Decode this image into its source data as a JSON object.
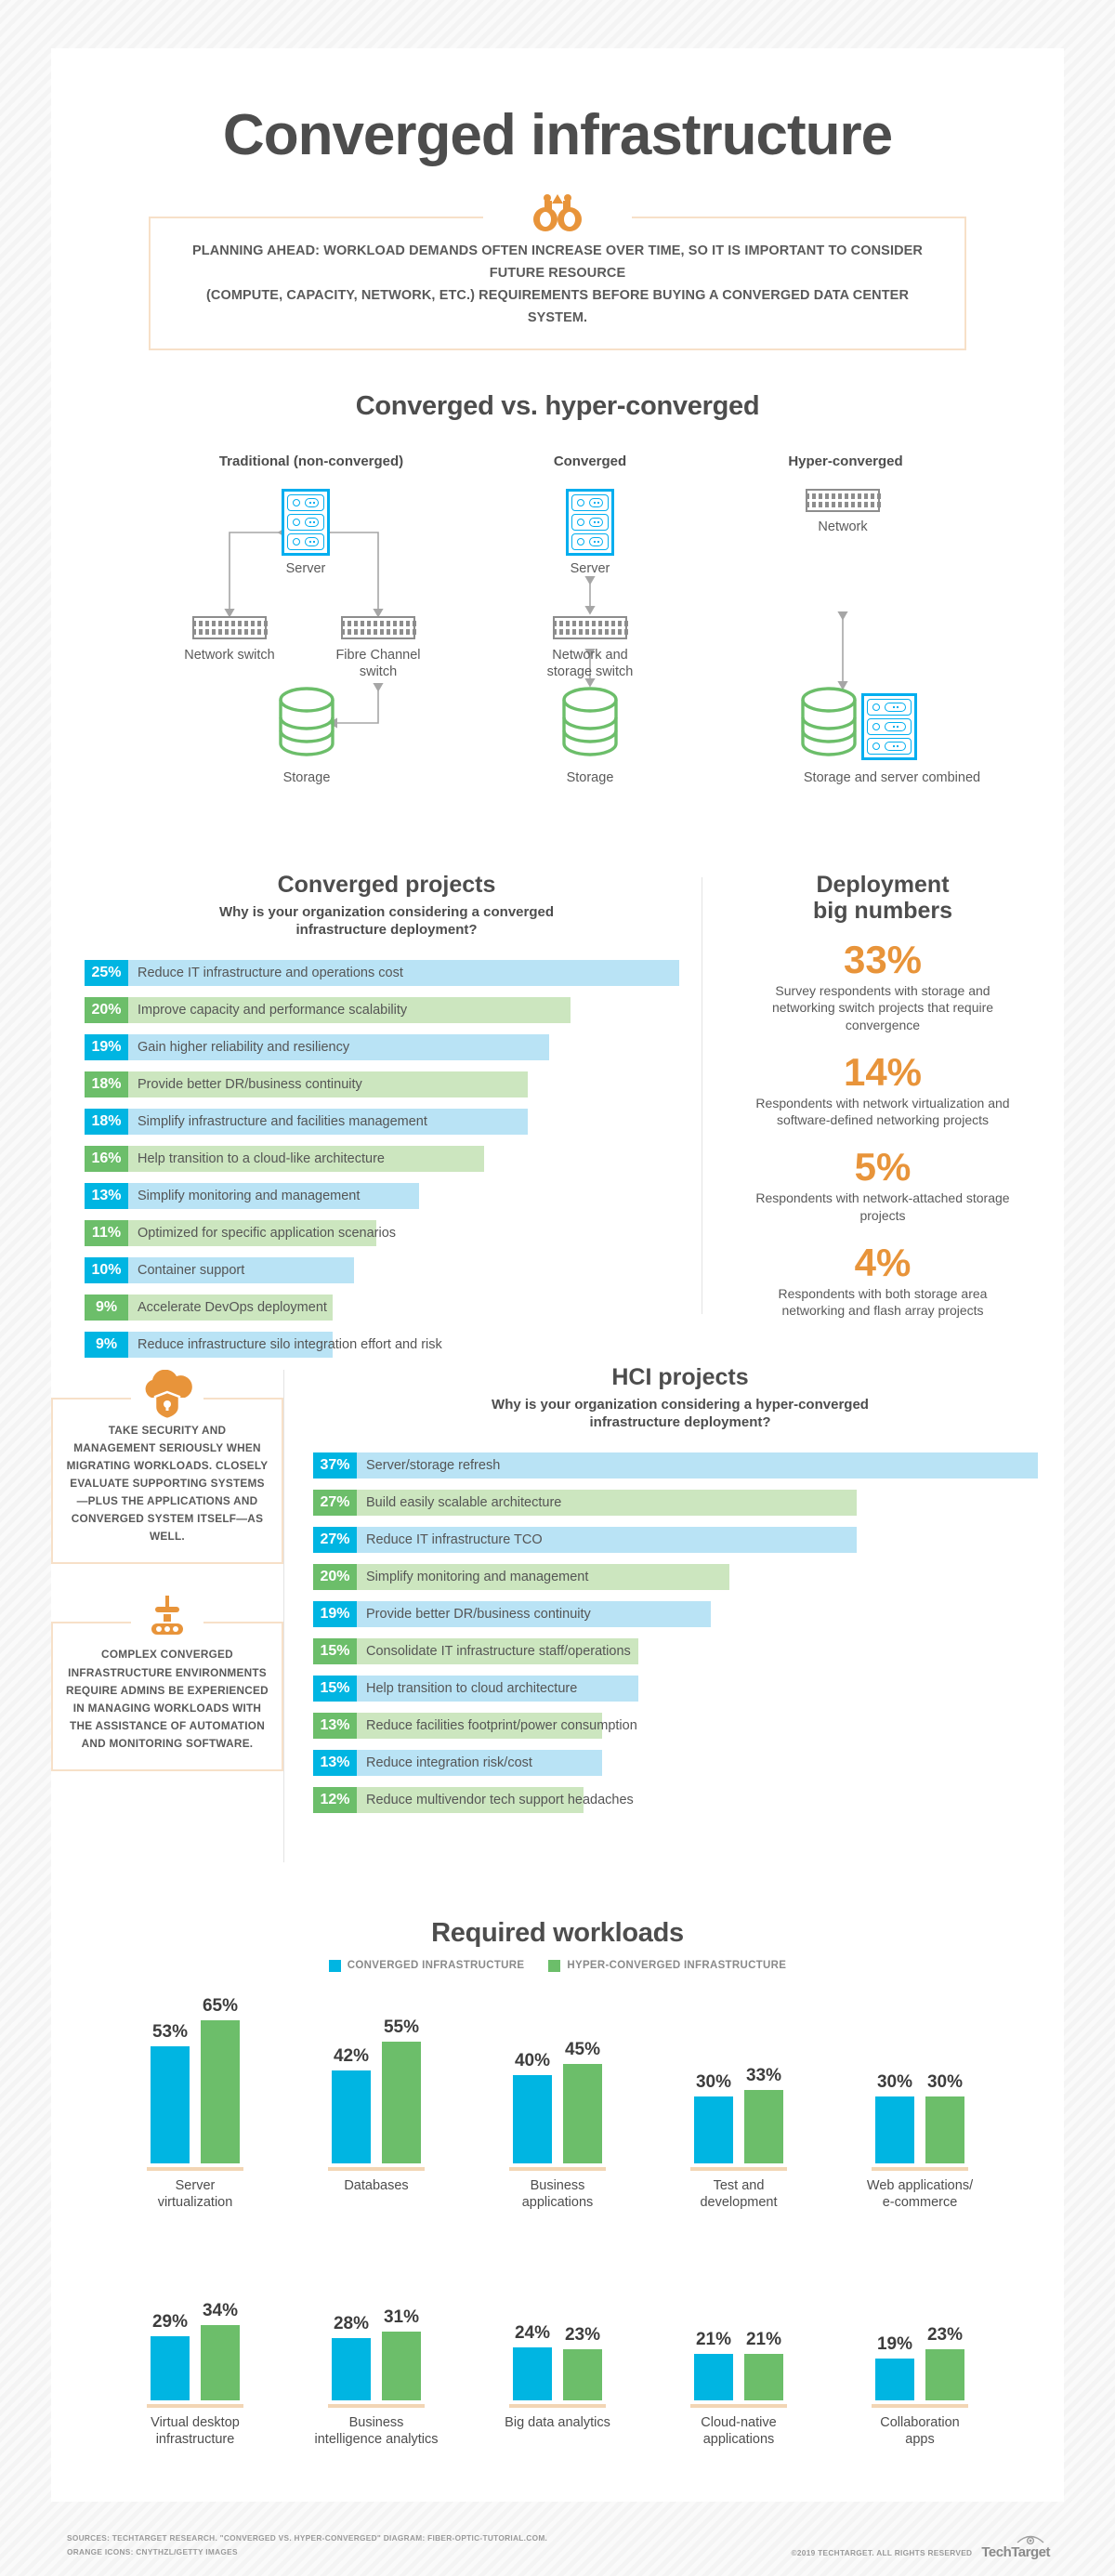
{
  "page": {
    "title": "Converged infrastructure"
  },
  "tip": {
    "icon": "binoculars-icon",
    "line1": "PLANNING AHEAD: WORKLOAD DEMANDS OFTEN INCREASE OVER TIME, SO IT IS IMPORTANT TO CONSIDER FUTURE RESOURCE",
    "line2": "(COMPUTE, CAPACITY, NETWORK, ETC.) REQUIREMENTS BEFORE BUYING A CONVERGED DATA CENTER SYSTEM."
  },
  "diagram": {
    "title": "Converged vs. hyper-converged",
    "columns": [
      {
        "heading": "Traditional (non-converged)"
      },
      {
        "heading": "Converged"
      },
      {
        "heading": "Hyper-converged"
      }
    ],
    "labels": {
      "server": "Server",
      "network_switch": "Network switch",
      "fibre_channel_switch": "Fibre Channel\nswitch",
      "fibre_channel_switch_l1": "Fibre Channel",
      "fibre_channel_switch_l2": "switch",
      "storage": "Storage",
      "network_and_storage_switch_l1": "Network and",
      "network_and_storage_switch_l2": "storage switch",
      "network": "Network",
      "storage_and_server_combined": "Storage and server combined"
    },
    "colors": {
      "server": "#00aeef",
      "switch": "#8d8d8d",
      "storage": "#6cbe6a",
      "arrow": "#a6a6a6"
    }
  },
  "converged_projects": {
    "title": "Converged projects",
    "subtitle_l1": "Why is your organization considering a converged",
    "subtitle_l2": "infrastructure deployment?"
  },
  "deployment_big_numbers": {
    "title_l1": "Deployment",
    "title_l2": "big numbers",
    "items": [
      {
        "value": "33%",
        "desc": "Survey respondents with storage and networking switch projects that require convergence"
      },
      {
        "value": "14%",
        "desc": "Respondents with network virtualization and software-defined networking projects"
      },
      {
        "value": "5%",
        "desc": "Respondents with network-attached storage projects"
      },
      {
        "value": "4%",
        "desc": "Respondents with both storage area networking and flash array projects"
      }
    ]
  },
  "callouts": [
    {
      "icon": "cloud-lock-icon",
      "text": "TAKE SECURITY AND MANAGEMENT SERIOUSLY WHEN MIGRATING WORKLOADS. CLOSELY EVALUATE SUPPORTING SYSTEMS—PLUS THE APPLICATIONS AND CONVERGED SYSTEM ITSELF—AS WELL."
    },
    {
      "icon": "conveyor-automation-icon",
      "text": "COMPLEX CONVERGED INFRASTRUCTURE ENVIRONMENTS REQUIRE ADMINS BE EXPERIENCED IN MANAGING WORKLOADS WITH THE ASSISTANCE OF AUTOMATION AND MONITORING SOFTWARE."
    }
  ],
  "hci_projects": {
    "title": "HCI projects",
    "subtitle_l1": "Why is your organization considering a hyper-converged",
    "subtitle_l2": "infrastructure deployment?"
  },
  "required_workloads": {
    "title": "Required workloads",
    "legend": [
      {
        "label": "CONVERGED INFRASTRUCTURE",
        "color": "#00b5e2"
      },
      {
        "label": "HYPER-CONVERGED INFRASTRUCTURE",
        "color": "#6cbe6a"
      }
    ]
  },
  "footer": {
    "source_line1": "SOURCES: TECHTARGET RESEARCH. \"CONVERGED VS. HYPER-CONVERGED\" DIAGRAM: FIBER-OPTIC-TUTORIAL.COM.",
    "source_line2": "ORANGE ICONS: CNYTHZL/GETTY IMAGES",
    "copyright": "©2019 TECHTARGET. ALL RIGHTS RESERVED",
    "logo": "TechTarget"
  },
  "chart_data": [
    {
      "type": "bar",
      "orientation": "horizontal",
      "title": "Converged projects",
      "subtitle": "Why is your organization considering a converged infrastructure deployment?",
      "xlabel": "",
      "ylabel": "",
      "xlim": [
        0,
        25
      ],
      "grid": false,
      "legend": "none",
      "categories": [
        "Reduce IT infrastructure and operations cost",
        "Improve capacity and performance scalability",
        "Gain higher reliability and resiliency",
        "Provide better DR/business continuity",
        "Simplify infrastructure and facilities management",
        "Help transition to a cloud-like architecture",
        "Simplify monitoring and management",
        "Optimized for specific application scenarios",
        "Container support",
        "Accelerate DevOps deployment",
        "Reduce infrastructure silo integration effort and risk"
      ],
      "values": [
        25,
        20,
        19,
        18,
        18,
        16,
        13,
        11,
        10,
        9,
        9
      ],
      "value_labels": [
        "25%",
        "20%",
        "19%",
        "18%",
        "18%",
        "16%",
        "13%",
        "11%",
        "10%",
        "9%",
        "9%"
      ],
      "bar_colors": [
        "blue",
        "green",
        "blue",
        "green",
        "blue",
        "green",
        "blue",
        "green",
        "blue",
        "green",
        "blue"
      ]
    },
    {
      "type": "bar",
      "orientation": "horizontal",
      "title": "HCI projects",
      "subtitle": "Why is your organization considering a hyper-converged infrastructure deployment?",
      "xlabel": "",
      "ylabel": "",
      "xlim": [
        0,
        37
      ],
      "grid": false,
      "legend": "none",
      "categories": [
        "Server/storage refresh",
        "Build easily scalable architecture",
        "Reduce IT infrastructure TCO",
        "Simplify monitoring and management",
        "Provide better DR/business continuity",
        "Consolidate IT infrastructure staff/operations",
        "Help transition to cloud architecture",
        "Reduce facilities footprint/power consumption",
        "Reduce integration risk/cost",
        "Reduce multivendor tech support headaches"
      ],
      "values": [
        37,
        27,
        27,
        20,
        19,
        15,
        15,
        13,
        13,
        12
      ],
      "value_labels": [
        "37%",
        "27%",
        "27%",
        "20%",
        "19%",
        "15%",
        "15%",
        "13%",
        "13%",
        "12%"
      ],
      "bar_colors": [
        "blue",
        "green",
        "blue",
        "green",
        "blue",
        "green",
        "blue",
        "green",
        "blue",
        "green"
      ]
    },
    {
      "type": "bar",
      "orientation": "vertical",
      "title": "Required workloads",
      "xlabel": "",
      "ylabel": "",
      "ylim": [
        0,
        65
      ],
      "grid": false,
      "legend": "top",
      "categories": [
        "Server virtualization",
        "Databases",
        "Business applications",
        "Test and development",
        "Web applications/e-commerce",
        "Virtual desktop infrastructure",
        "Business intelligence analytics",
        "Big data analytics",
        "Cloud-native applications",
        "Collaboration apps"
      ],
      "category_lines": [
        [
          "Server",
          "virtualization"
        ],
        [
          "Databases"
        ],
        [
          "Business",
          "applications"
        ],
        [
          "Test and",
          "development"
        ],
        [
          "Web applications/",
          "e-commerce"
        ],
        [
          "Virtual desktop",
          "infrastructure"
        ],
        [
          "Business",
          "intelligence analytics"
        ],
        [
          "Big data analytics"
        ],
        [
          "Cloud-native",
          "applications"
        ],
        [
          "Collaboration",
          "apps"
        ]
      ],
      "series": [
        {
          "name": "CONVERGED INFRASTRUCTURE",
          "color": "#00b5e2",
          "values": [
            53,
            42,
            40,
            30,
            30,
            29,
            28,
            24,
            21,
            19
          ],
          "value_labels": [
            "53%",
            "42%",
            "40%",
            "30%",
            "30%",
            "29%",
            "28%",
            "24%",
            "21%",
            "19%"
          ]
        },
        {
          "name": "HYPER-CONVERGED INFRASTRUCTURE",
          "color": "#6cbe6a",
          "values": [
            65,
            55,
            45,
            33,
            30,
            34,
            31,
            23,
            21,
            23
          ],
          "value_labels": [
            "65%",
            "55%",
            "45%",
            "33%",
            "30%",
            "34%",
            "31%",
            "23%",
            "21%",
            "23%"
          ]
        }
      ]
    }
  ]
}
